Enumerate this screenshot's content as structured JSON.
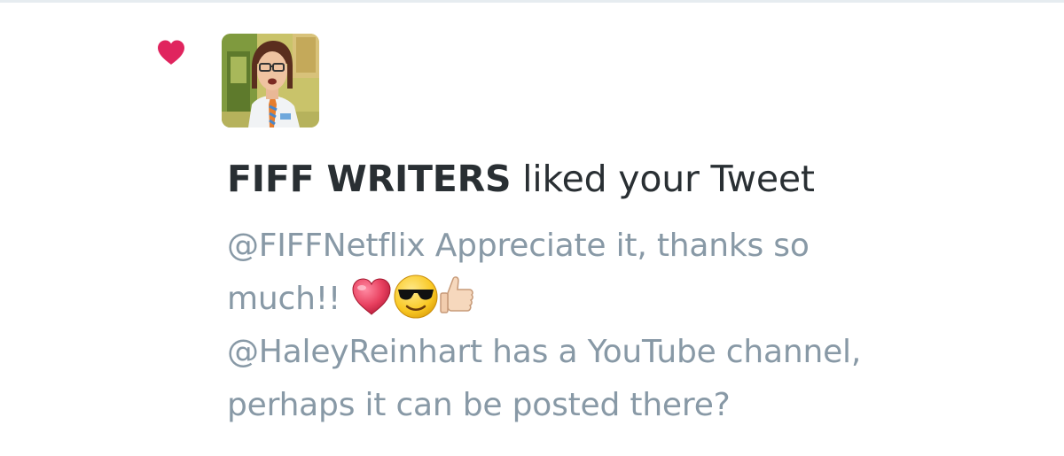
{
  "notification": {
    "type_icon": "heart-icon",
    "actor_name": "FIFF WRITERS",
    "action_text": " liked your Tweet",
    "tweet": {
      "mention": "@FIFFNetflix",
      "line1_rest": " Appreciate it, thanks so",
      "line2": "much!! ",
      "emojis": [
        "red-heart",
        "smiling-face-with-sunglasses",
        "thumbs-up"
      ],
      "line3": "@HaleyReinhart has a YouTube channel,",
      "line4": "perhaps it can be posted there?"
    }
  },
  "colors": {
    "like_heart": "#e0245e",
    "name_text": "#292f33",
    "tweet_text": "#8899a6",
    "divider": "#e6ecf0"
  }
}
